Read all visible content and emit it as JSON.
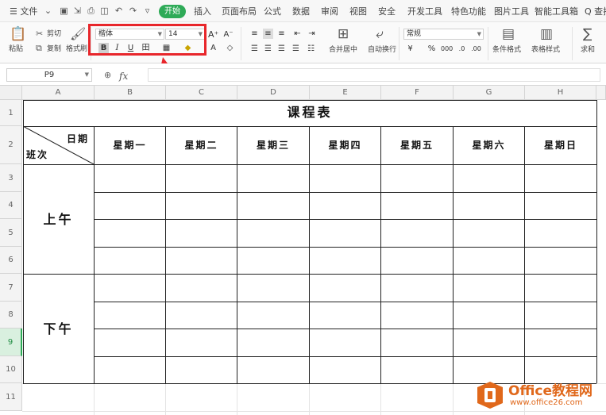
{
  "menubar": {
    "file_label": "☰ 文件",
    "tabs": [
      "开始",
      "插入",
      "页面布局",
      "公式",
      "数据",
      "审阅",
      "视图",
      "安全",
      "开发工具",
      "特色功能",
      "图片工具",
      "智能工具箱"
    ],
    "search_label": "Q 查找"
  },
  "ribbon": {
    "paste": "粘贴",
    "cut": "剪切",
    "copy": "复制",
    "format_painter": "格式刷",
    "font_name": "楷体",
    "font_size": "14",
    "merge_center": "合并居中",
    "wrap_text": "自动换行",
    "number_format": "常规",
    "conditional_format": "条件格式",
    "table_style": "表格样式",
    "sum": "求和"
  },
  "formula_bar": {
    "cell_ref": "P9",
    "fx": "fx",
    "formula": ""
  },
  "sheet": {
    "columns": [
      "A",
      "B",
      "C",
      "D",
      "E",
      "F",
      "G",
      "H"
    ],
    "rows": [
      "1",
      "2",
      "3",
      "4",
      "5",
      "6",
      "7",
      "8",
      "9",
      "10",
      "11"
    ],
    "active_row": "9",
    "title": "课程表",
    "corner_top": "日期",
    "corner_bottom": "班次",
    "days": [
      "星期一",
      "星期二",
      "星期三",
      "星期四",
      "星期五",
      "星期六",
      "星期日"
    ],
    "morning": "上午",
    "afternoon": "下午"
  },
  "watermark": {
    "brand": "Office教程网",
    "url": "www.office26.com"
  },
  "colors": {
    "accent_green": "#2eaa57",
    "highlight_red": "#e8262b",
    "watermark_orange": "#e0681b"
  }
}
